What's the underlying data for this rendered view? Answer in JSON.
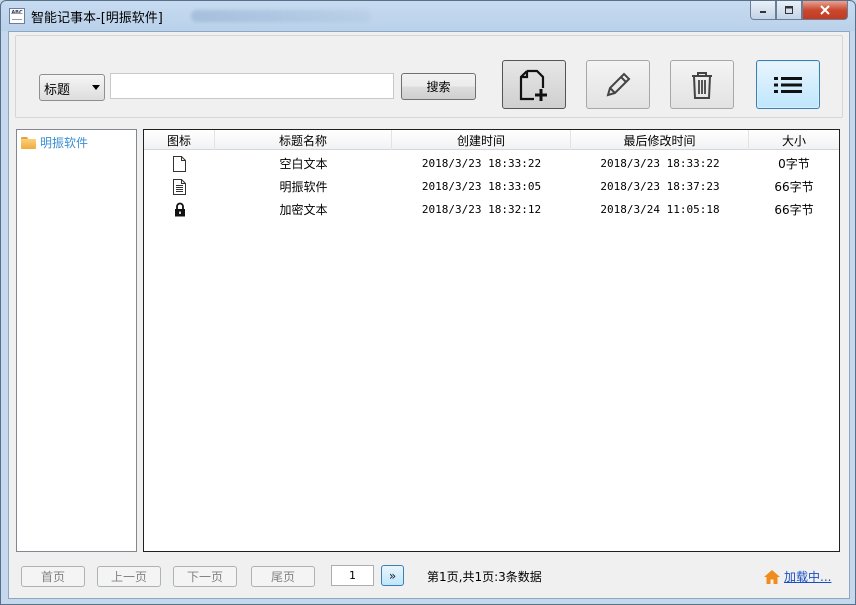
{
  "window": {
    "title": "智能记事本-[明振软件]",
    "controls": {
      "minimize": "—",
      "maximize": "□",
      "close": "✕"
    }
  },
  "toolbar": {
    "field_select": "标题",
    "search_value": "",
    "search_button": "搜索",
    "buttons": {
      "new": "new-document-icon",
      "edit": "pencil-icon",
      "delete": "trash-icon",
      "list": "list-icon"
    }
  },
  "tree": {
    "items": [
      {
        "label": "明振软件",
        "icon": "folder-icon"
      }
    ]
  },
  "grid": {
    "columns": [
      "图标",
      "标题名称",
      "创建时间",
      "最后修改时间",
      "大小"
    ],
    "rows": [
      {
        "icon": "blank-document-icon",
        "title": "空白文本",
        "created": "2018/3/23 18:33:22",
        "modified": "2018/3/23 18:33:22",
        "size": "0字节"
      },
      {
        "icon": "text-document-icon",
        "title": "明振软件",
        "created": "2018/3/23 18:33:05",
        "modified": "2018/3/23 18:37:23",
        "size": "66字节"
      },
      {
        "icon": "lock-icon",
        "title": "加密文本",
        "created": "2018/3/23 18:32:12",
        "modified": "2018/3/24 11:05:18",
        "size": "66字节"
      }
    ]
  },
  "pagination": {
    "first": "首页",
    "prev": "上一页",
    "next": "下一页",
    "last": "尾页",
    "page_value": "1",
    "go": "»",
    "info": "第1页,共1页:3条数据"
  },
  "status": {
    "loading": "加载中...",
    "loading_icon": "home-icon"
  },
  "colors": {
    "accent": "#3b8fd3",
    "link": "#1a4fc4"
  }
}
